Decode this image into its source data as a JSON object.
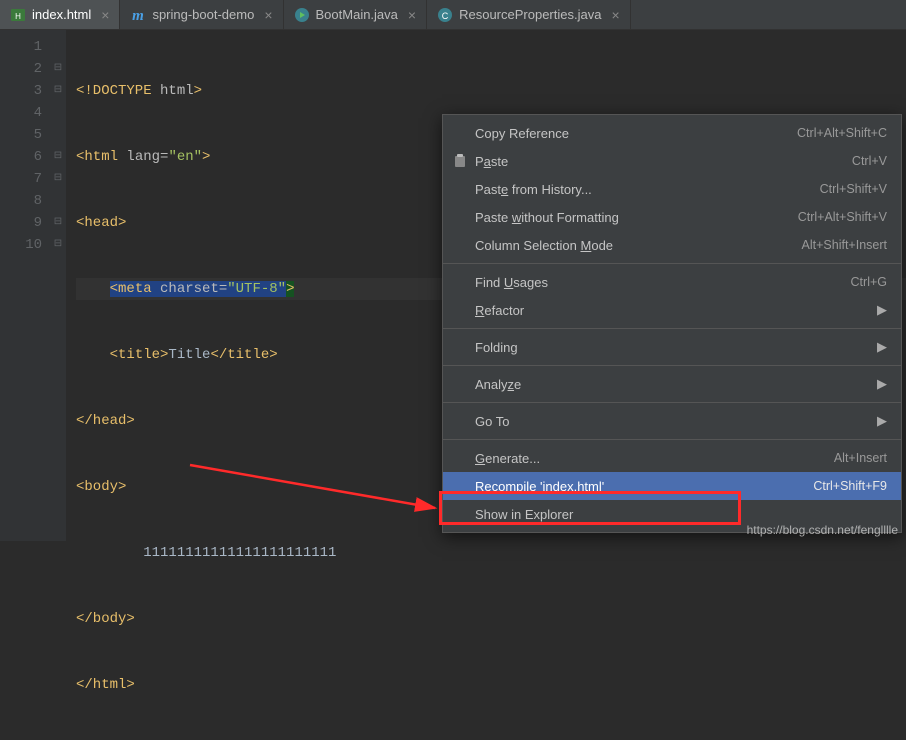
{
  "tabs": [
    {
      "label": "index.html",
      "icon": "html"
    },
    {
      "label": "spring-boot-demo",
      "icon": "maven"
    },
    {
      "label": "BootMain.java",
      "icon": "java-run"
    },
    {
      "label": "ResourceProperties.java",
      "icon": "java-class"
    }
  ],
  "code": {
    "l1_a": "<!DOCTYPE ",
    "l1_b": "html",
    "l1_c": ">",
    "l2_a": "<html ",
    "l2_b": "lang=",
    "l2_c": "\"en\"",
    "l2_d": ">",
    "l3": "<head>",
    "l4_a": "<meta ",
    "l4_b": "charset=",
    "l4_c": "\"UTF-8\"",
    "l4_d": ">",
    "l5_a": "<title>",
    "l5_b": "Title",
    "l5_c": "</title>",
    "l6": "</head>",
    "l7": "<body>",
    "l8": "11111111111111111111111",
    "l9": "</body>",
    "l10": "</html>"
  },
  "gutter": [
    "1",
    "2",
    "3",
    "4",
    "5",
    "6",
    "7",
    "8",
    "9",
    "10"
  ],
  "menu": {
    "copy_ref": "Copy Reference",
    "copy_ref_s": "Ctrl+Alt+Shift+C",
    "paste_pre": "P",
    "paste_u": "a",
    "paste_post": "ste",
    "paste_s": "Ctrl+V",
    "phist_pre": "Past",
    "phist_u": "e",
    "phist_post": " from History...",
    "phist_s": "Ctrl+Shift+V",
    "pnofmt_pre": "Paste ",
    "pnofmt_u": "w",
    "pnofmt_post": "ithout Formatting",
    "pnofmt_s": "Ctrl+Alt+Shift+V",
    "colsel_pre": "Column Selection ",
    "colsel_u": "M",
    "colsel_post": "ode",
    "colsel_s": "Alt+Shift+Insert",
    "find_pre": "Find ",
    "find_u": "U",
    "find_post": "sages",
    "find_s": "Ctrl+G",
    "refac_u": "R",
    "refac_post": "efactor",
    "folding": "Folding",
    "analyze_pre": "Analy",
    "analyze_u": "z",
    "analyze_post": "e",
    "goto": "Go To",
    "gen_u": "G",
    "gen_post": "enerate...",
    "gen_s": "Alt+Insert",
    "recomp_pre": "R",
    "recomp_u": "e",
    "recomp_post": "compile 'index.html'",
    "recomp_s": "Ctrl+Shift+F9",
    "showex": "Show in Explorer"
  },
  "watermark": "https://blog.csdn.net/fenglllle"
}
